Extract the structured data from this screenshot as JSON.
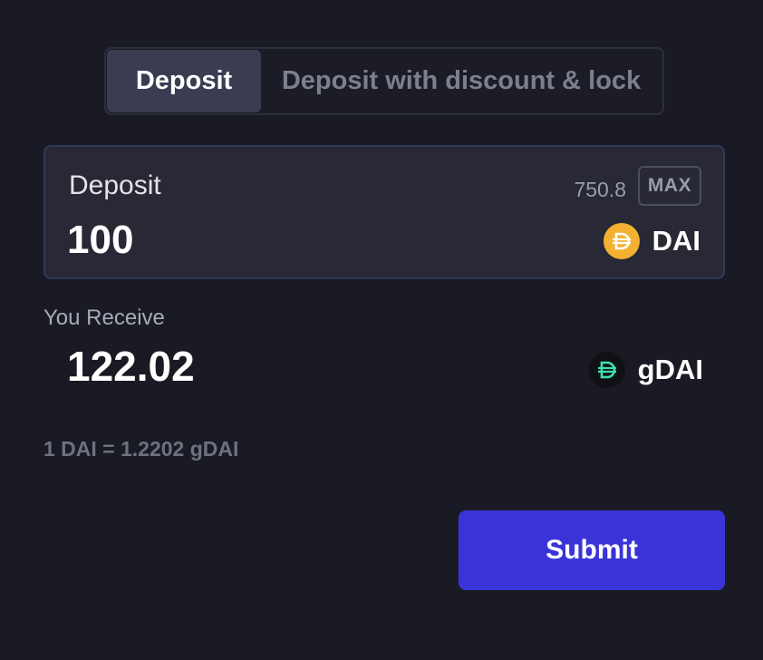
{
  "tabs": [
    {
      "label": "Deposit",
      "active": true
    },
    {
      "label": "Deposit with discount & lock",
      "active": false
    }
  ],
  "deposit": {
    "label": "Deposit",
    "balance": "750.8",
    "max_label": "MAX",
    "amount": "100",
    "token": {
      "symbol": "DAI",
      "icon": "dai-token-icon",
      "color": "#f4b131"
    }
  },
  "receive": {
    "label": "You Receive",
    "amount": "122.02",
    "token": {
      "symbol": "gDAI",
      "icon": "gdai-token-icon",
      "color": "#3fe0b0"
    }
  },
  "rate": "1 DAI = 1.2202 gDAI",
  "submit_label": "Submit",
  "colors": {
    "background": "#191a23",
    "card": "#282935",
    "accent": "#3a34d8",
    "active_tab": "#3a3d52"
  }
}
